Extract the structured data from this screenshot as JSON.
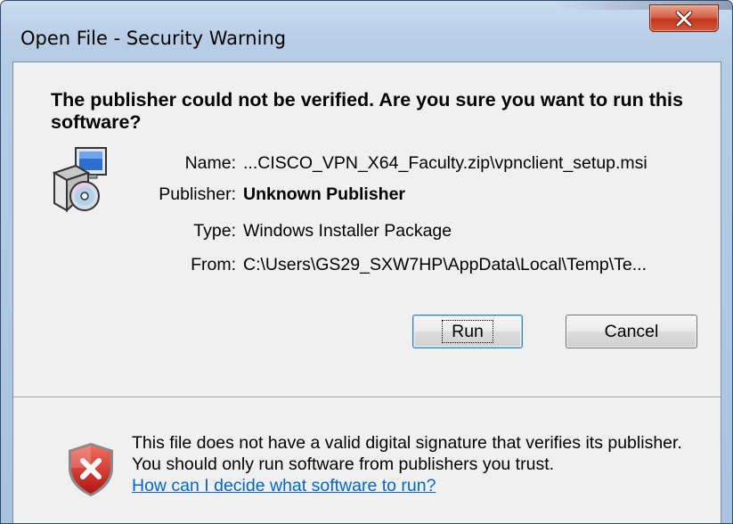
{
  "window": {
    "title": "Open File - Security Warning",
    "close_icon": "close-x-icon"
  },
  "heading": "The publisher could not be verified.  Are you sure you want to run this software?",
  "file_icon": "installer-package-icon",
  "details": [
    {
      "label": "Name:",
      "value": "...CISCO_VPN_X64_Faculty.zip\\vpnclient_setup.msi",
      "bold": false
    },
    {
      "label": "Publisher:",
      "value": "Unknown Publisher",
      "bold": true
    },
    {
      "label": "Type:",
      "value": "Windows Installer Package",
      "bold": false
    },
    {
      "label": "From:",
      "value": "C:\\Users\\GS29_SXW7HP\\AppData\\Local\\Temp\\Te...",
      "bold": false
    }
  ],
  "buttons": {
    "run_label": "Run",
    "cancel_label": "Cancel"
  },
  "footer": {
    "icon": "shield-error-icon",
    "message": "This file does not have a valid digital signature that verifies its publisher.  You should only run software from publishers you trust.",
    "link_text": "How can I decide what software to run?"
  },
  "colors": {
    "link": "#0066cc",
    "close_button": "#c1361c",
    "dialog_background": "#f0f0f0"
  }
}
